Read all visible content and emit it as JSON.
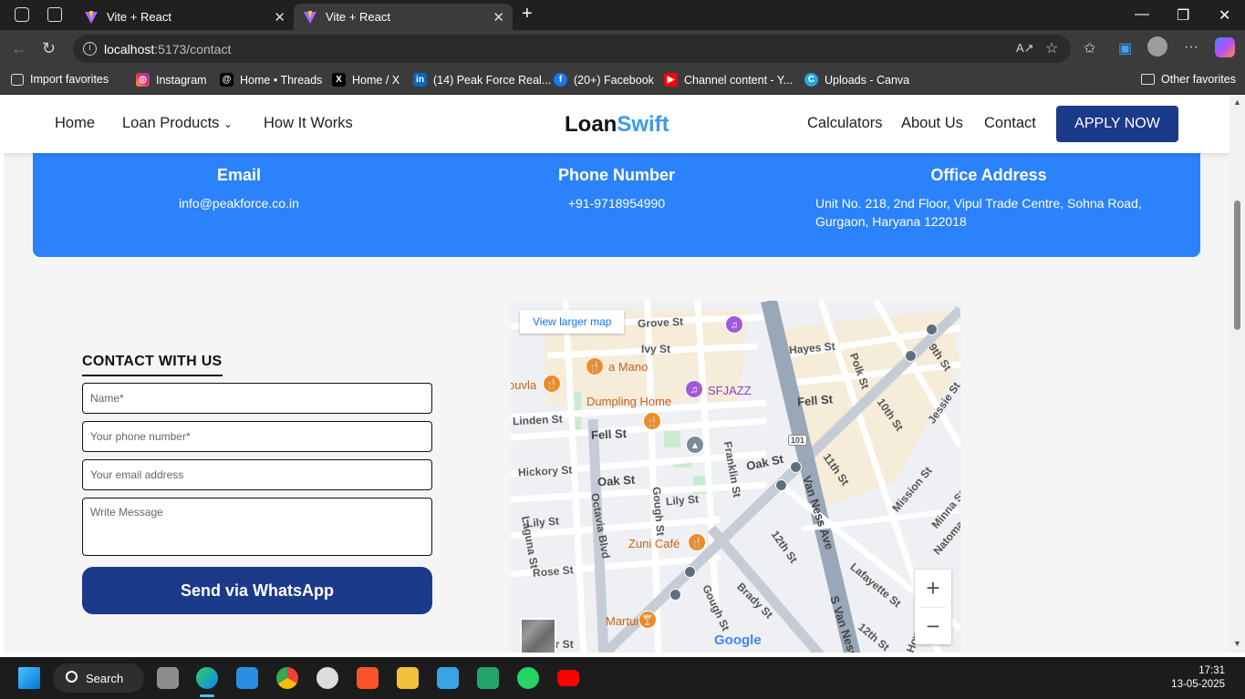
{
  "browser": {
    "tabs": [
      {
        "title": "Vite + React",
        "active": false
      },
      {
        "title": "Vite + React",
        "active": true
      }
    ],
    "url_host": "localhost",
    "url_path": ":5173/contact",
    "bookmarks": [
      {
        "label": "Import favorites",
        "icon": "import-icon"
      },
      {
        "label": "Instagram",
        "icon": "instagram-icon"
      },
      {
        "label": "Home • Threads",
        "icon": "threads-icon"
      },
      {
        "label": "Home / X",
        "icon": "x-icon"
      },
      {
        "label": "(14) Peak Force Real...",
        "icon": "linkedin-icon"
      },
      {
        "label": "(20+) Facebook",
        "icon": "facebook-icon"
      },
      {
        "label": "Channel content - Y...",
        "icon": "youtube-icon"
      },
      {
        "label": "Uploads - Canva",
        "icon": "canva-icon"
      }
    ],
    "other_favorites": "Other favorites"
  },
  "site": {
    "nav": {
      "home": "Home",
      "loan_products": "Loan Products",
      "how_it_works": "How It Works",
      "calculators": "Calculators",
      "about_us": "About Us",
      "contact": "Contact",
      "apply": "APPLY NOW"
    },
    "brand": {
      "part1": "Loan",
      "part2": "Swift",
      "accent_color": "#3e9ae8"
    },
    "info": {
      "email_title": "Email",
      "email_value": "info@peakforce.co.in",
      "phone_title": "Phone Number",
      "phone_value": "+91-9718954990",
      "address_title": "Office Address",
      "address_line1": "Unit No. 218, 2nd Floor, Vipul Trade Centre, Sohna Road,",
      "address_line2": "Gurgaon, Haryana 122018",
      "band_color": "#2b82fb"
    },
    "form": {
      "title": "CONTACT WITH US",
      "name_placeholder": "Name*",
      "phone_placeholder": "Your phone number*",
      "email_placeholder": "Your email address",
      "message_placeholder": "Write Message",
      "submit": "Send via WhatsApp",
      "button_color": "#1c3a8a"
    },
    "map": {
      "view_larger": "View larger map",
      "streets": [
        "Grove St",
        "Ivy St",
        "Hayes St",
        "Polk St",
        "9th St",
        "10th St",
        "Jessie St",
        "Fell St",
        "Linden St",
        "Franklin St",
        "Oak St",
        "Hickory St",
        "Octavia Blvd",
        "Gough St",
        "Lily St",
        "Van Ness Ave",
        "11th St",
        "Mission St",
        "Minna St",
        "Natoma",
        "Laguna St",
        "12th St",
        "Rose St",
        "Lafayette St",
        "Brady St",
        "S Van Ness",
        "Haller St",
        "Howard",
        "101"
      ],
      "pois": [
        "a Mano",
        "SFJAZZ",
        "Dumpling Home",
        "Zuni Café",
        "Martuni's",
        "ouvla"
      ],
      "google": "Google",
      "zoom_in": "+",
      "zoom_out": "−"
    }
  },
  "taskbar": {
    "search": "Search",
    "time": "17:31",
    "date": "13-05-2025"
  }
}
